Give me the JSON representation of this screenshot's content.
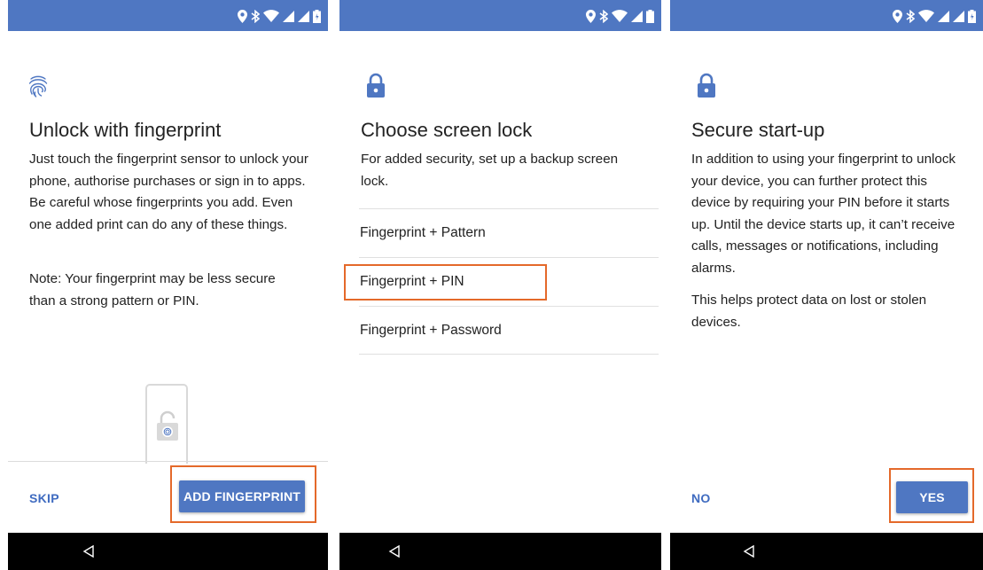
{
  "screens": [
    {
      "title": "Unlock with fingerprint",
      "body": "Just touch the fingerprint sensor to unlock your phone, authorise purchases or sign in to apps. Be careful whose fingerprints you add. Even one added print can do any of these things.",
      "note": "Note: Your fingerprint may be less secure than a strong pattern or PIN.",
      "skip_label": "SKIP",
      "add_label": "ADD FINGERPRINT",
      "header_icon": "fingerprint-icon"
    },
    {
      "title": "Choose screen lock",
      "body": "For added security, set up a backup screen lock.",
      "options": [
        "Fingerprint + Pattern",
        "Fingerprint + PIN",
        "Fingerprint + Password"
      ],
      "header_icon": "lock-icon"
    },
    {
      "title": "Secure start-up",
      "body": "In addition to using your fingerprint to unlock your device, you can further protect this device by requiring your PIN before it starts up. Until the device starts up, it can’t receive calls, messages or notifications, including alarms.",
      "body2": "This helps protect data on lost or stolen devices.",
      "no_label": "NO",
      "yes_label": "YES",
      "header_icon": "lock-icon"
    }
  ],
  "colors": {
    "status_bar": "#4f77c2",
    "accent_button": "#4f77c2",
    "text_button": "#3f6bc0",
    "highlight": "#e4692a",
    "nav_bar": "#000000"
  }
}
